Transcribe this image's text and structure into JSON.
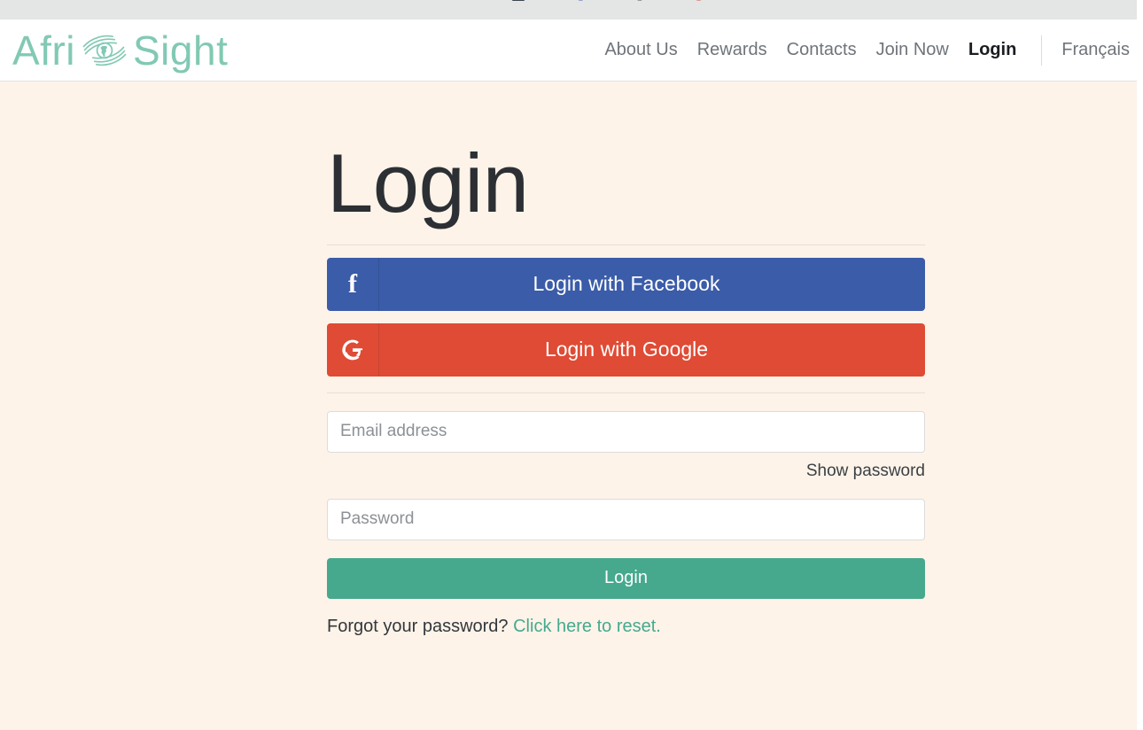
{
  "browser_strip": {
    "clipped_tabs": [
      "",
      "",
      "",
      ""
    ],
    "icons": [
      "monitor-icon",
      "bookmark-icon",
      "bookmark-icon",
      "bookmark-icon"
    ]
  },
  "header": {
    "logo": {
      "text_before": "Afri",
      "text_after": "Sight",
      "icon": "eye-africa-icon",
      "color": "#82c9b4"
    },
    "nav": [
      {
        "label": "About Us",
        "active": false
      },
      {
        "label": "Rewards",
        "active": false
      },
      {
        "label": "Contacts",
        "active": false
      },
      {
        "label": "Join Now",
        "active": false
      },
      {
        "label": "Login",
        "active": true
      }
    ],
    "language": {
      "label": "Français"
    }
  },
  "main": {
    "title": "Login",
    "social": {
      "facebook": {
        "label": "Login with Facebook",
        "icon": "facebook-f-icon",
        "color": "#3b5ca8"
      },
      "google": {
        "label": "Login with Google",
        "icon": "google-g-icon",
        "color": "#df4b35"
      }
    },
    "form": {
      "email_placeholder": "Email address",
      "email_value": "",
      "password_placeholder": "Password",
      "password_value": "",
      "show_password_label": "Show password",
      "submit_label": "Login"
    },
    "forgot": {
      "text": "Forgot your password?",
      "link_label": "Click here to reset.",
      "link_color": "#46a98d"
    }
  },
  "theme": {
    "page_background": "#fdf3e9",
    "header_background": "#ffffff",
    "accent_green": "#46a98d",
    "logo_green": "#82c9b4"
  }
}
